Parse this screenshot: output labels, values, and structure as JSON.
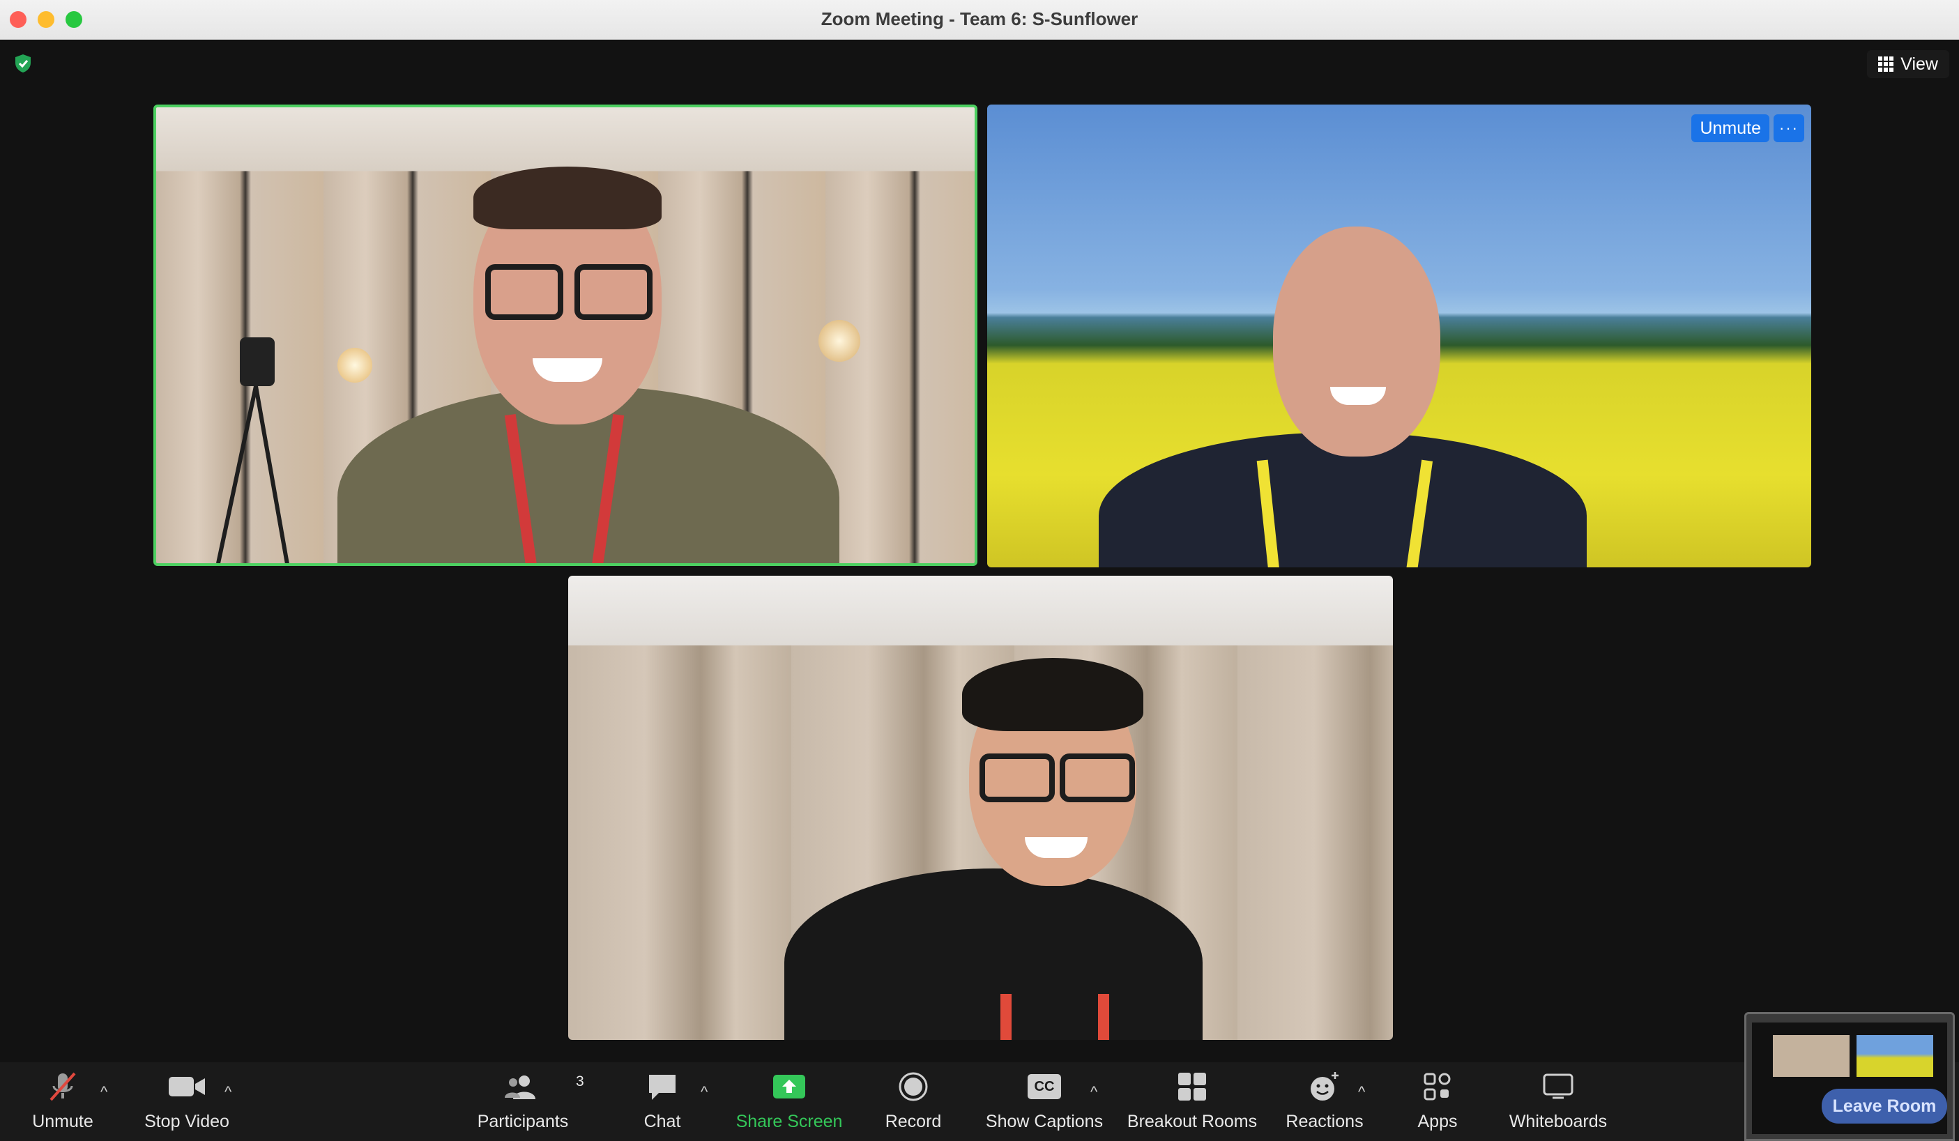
{
  "window": {
    "title": "Zoom Meeting - Team 6: S-Sunflower"
  },
  "topbar": {
    "view_label": "View"
  },
  "tiles": {
    "tile2": {
      "unmute_label": "Unmute",
      "more_label": "···"
    }
  },
  "toolbar": {
    "unmute_label": "Unmute",
    "stop_video_label": "Stop Video",
    "participants_label": "Participants",
    "participants_count": "3",
    "chat_label": "Chat",
    "share_screen_label": "Share Screen",
    "record_label": "Record",
    "show_captions_label": "Show Captions",
    "captions_icon_text": "CC",
    "breakout_rooms_label": "Breakout Rooms",
    "reactions_label": "Reactions",
    "apps_label": "Apps",
    "whiteboards_label": "Whiteboards"
  },
  "thumbnail": {
    "leave_label": "Leave Room"
  },
  "colors": {
    "active_speaker_border": "#4dd061",
    "share_green": "#34c759",
    "accent_blue": "#1a73e8",
    "mic_muted_red": "#e0483e"
  }
}
